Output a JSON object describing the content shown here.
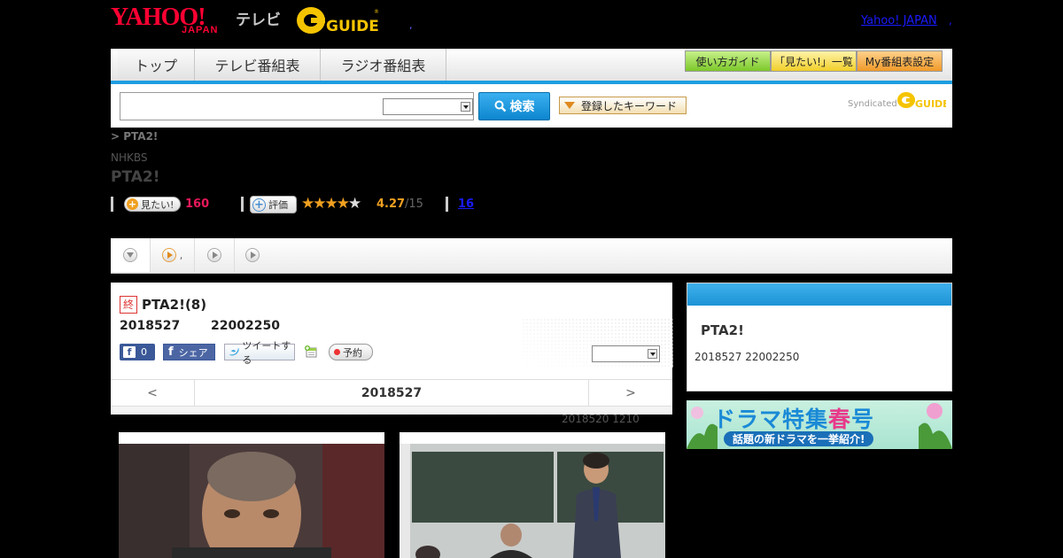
{
  "header": {
    "yahoo_logo": "YAHOO!",
    "japan_logo": "JAPAN",
    "tv_label": "テレビ",
    "gguide_logo": "GUIDE",
    "dot": ",",
    "yahoo_japan_link": "Yahoo! JAPAN",
    "link_dot": ","
  },
  "nav": {
    "tabs": [
      "トップ",
      "テレビ番組表",
      "ラジオ番組表"
    ],
    "buttons": [
      "使い方ガイド",
      "「見たい!」一覧",
      "My番組表設定"
    ]
  },
  "search": {
    "input_value": "",
    "select_value": "",
    "button_label": "検索",
    "keyword_button": "登録したキーワード",
    "syndicated": "Syndicated"
  },
  "program": {
    "breadcrumb": "> PTA2!",
    "channel": "NHKBS",
    "title": "PTA2!",
    "want_label": "見たい!",
    "want_count": "160",
    "rate_label": "評価",
    "rating": "4.27",
    "rating_of": "/15",
    "stars": 4.27,
    "link_count": "16"
  },
  "subtabs": {
    "tab2_text": ","
  },
  "episode": {
    "end_badge": "終",
    "title": "PTA2!(8)",
    "date": "2018527",
    "time": "22002250",
    "fb_count": "0",
    "fb_share": "シェア",
    "tweet": "ツイートする",
    "reserve": "予約",
    "select_value": "",
    "prev": "<",
    "next": ">",
    "date_label": "2018527",
    "updated": "2018520 1210"
  },
  "sidebar": {
    "title": "PTA2!",
    "date": "2018527  22002250",
    "banner_line1a": "ドラマ特集",
    "banner_line1b": "春",
    "banner_line1c": "号",
    "banner_line2": "話題の新ドラマを一挙紹介!"
  },
  "colors": {
    "accent": "#1e9ee0",
    "yahoo_red": "#ff0033",
    "want_pink": "#e8185a",
    "star_gold": "#f0a020",
    "green_btn": "#8bd43a",
    "yellow_btn": "#f5d63a",
    "orange_btn": "#f5a23a"
  }
}
